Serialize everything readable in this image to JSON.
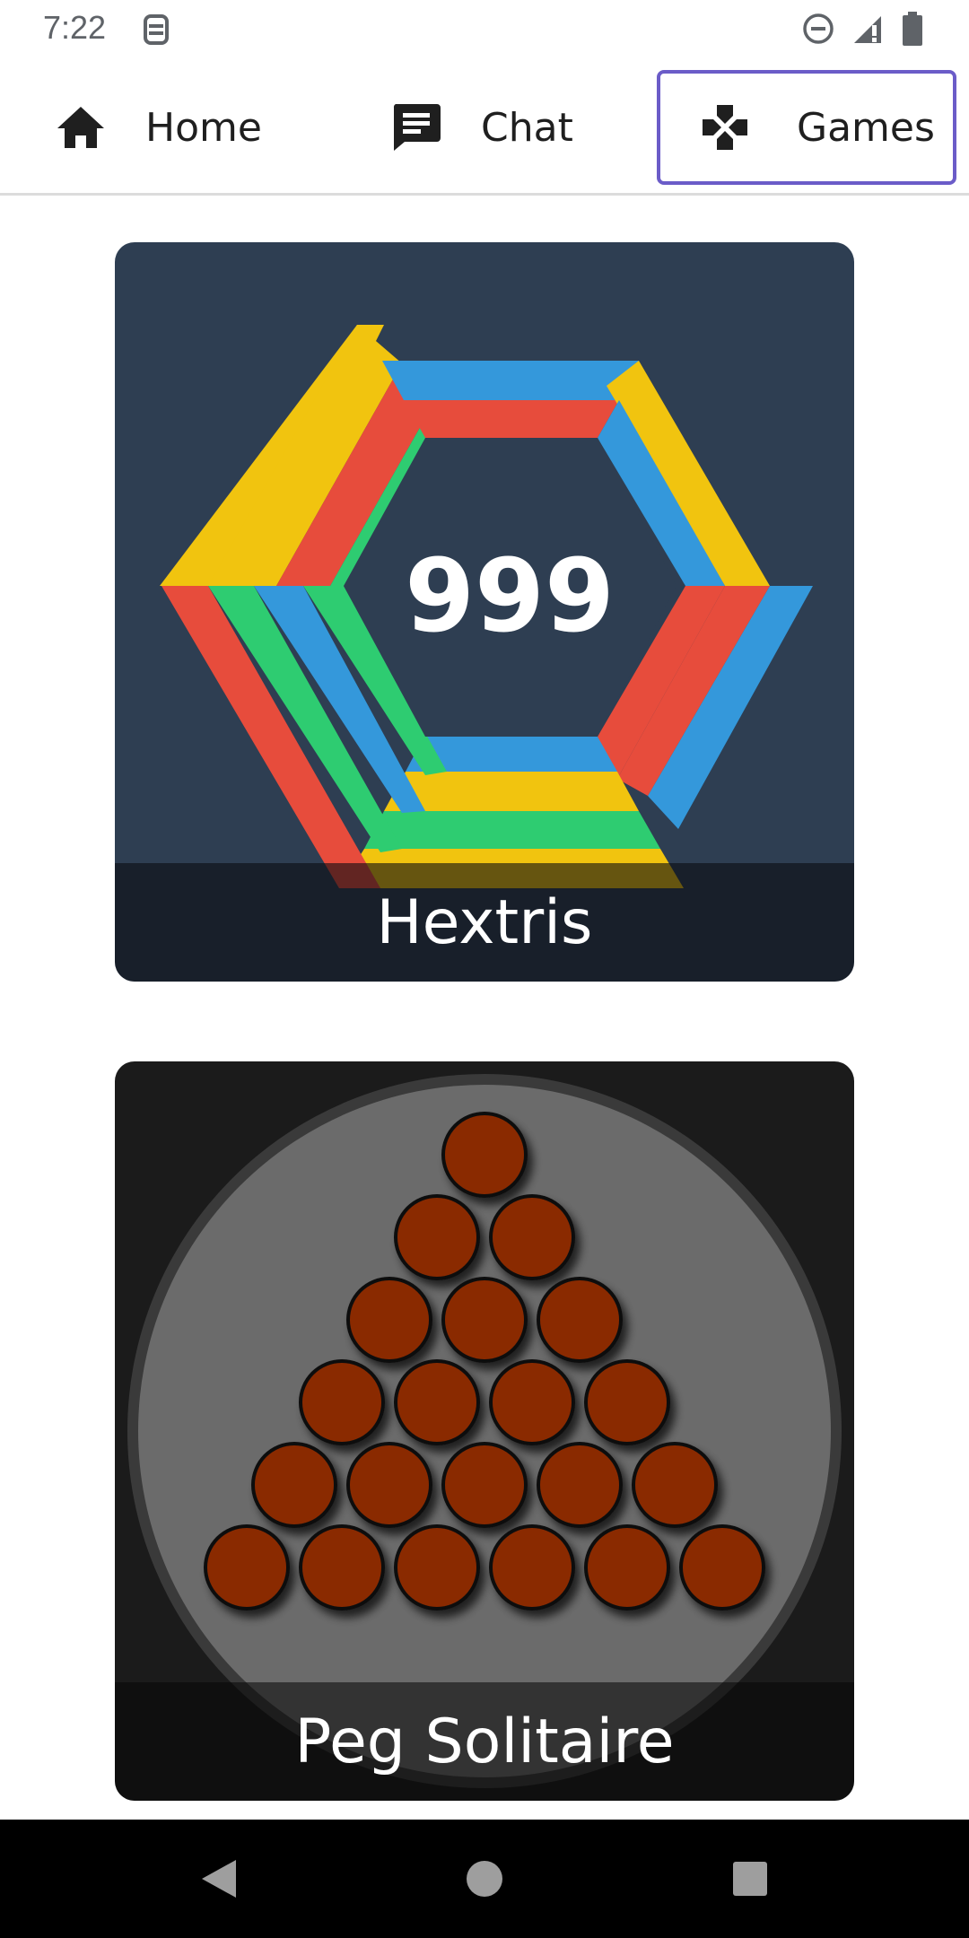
{
  "status_bar": {
    "time": "7:22"
  },
  "top_nav": {
    "items": [
      {
        "label": "Home",
        "icon": "home-icon"
      },
      {
        "label": "Chat",
        "icon": "chat-icon"
      },
      {
        "label": "Games",
        "icon": "gamepad-icon",
        "selected": true
      }
    ]
  },
  "games": [
    {
      "title": "Hextris",
      "score": "999"
    },
    {
      "title": "Peg Solitaire"
    }
  ],
  "colors": {
    "accent": "#6b5cc8",
    "hextris_bg": "#2e3e52",
    "hex_red": "#e74c3c",
    "hex_yellow": "#f1c40f",
    "hex_blue": "#3498db",
    "hex_green": "#2ecc71",
    "peg": "#8a2a00"
  }
}
